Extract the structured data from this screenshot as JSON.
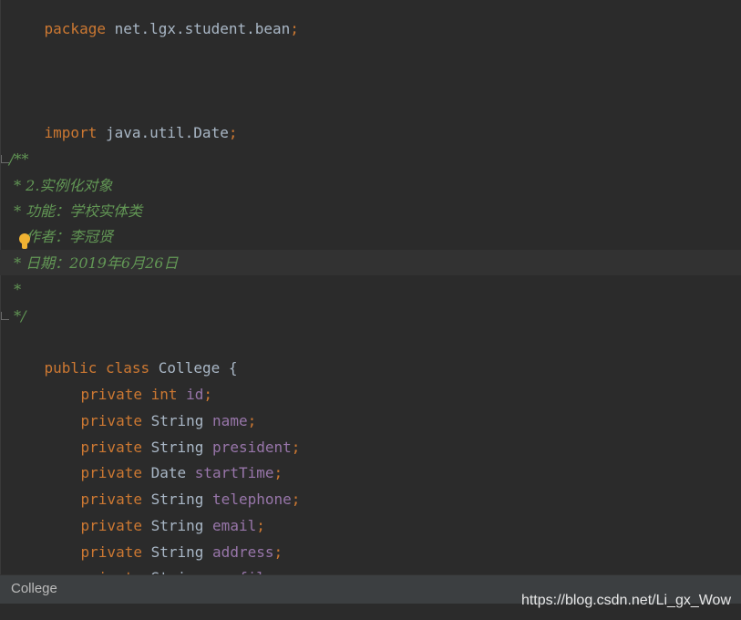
{
  "editor": {
    "package_line": {
      "keyword": "package",
      "name": "net.lgx.student.bean",
      "semi": ";"
    },
    "import_line": {
      "keyword": "import",
      "name": "java.util.Date",
      "semi": ";"
    },
    "javadoc": {
      "open": "/**",
      "line1": " * 2.实例化对象",
      "line2": " * 功能：学校实体类",
      "line3_prefix": " * ",
      "line3": "作者：李冠贤",
      "line4": " * 日期：2019年6月26日",
      "line5": " *",
      "close": " */"
    },
    "class_decl": {
      "kw1": "public",
      "kw2": "class",
      "name": "College",
      "brace": "{"
    },
    "fields": [
      {
        "mod": "private",
        "type": "int",
        "name": "id",
        "type_is_keyword": true
      },
      {
        "mod": "private",
        "type": "String",
        "name": "name"
      },
      {
        "mod": "private",
        "type": "String",
        "name": "president"
      },
      {
        "mod": "private",
        "type": "Date",
        "name": "startTime"
      },
      {
        "mod": "private",
        "type": "String",
        "name": "telephone"
      },
      {
        "mod": "private",
        "type": "String",
        "name": "email"
      },
      {
        "mod": "private",
        "type": "String",
        "name": "address"
      },
      {
        "mod": "private",
        "type": "String",
        "name": "profile"
      }
    ],
    "semi": ";"
  },
  "statusbar": {
    "breadcrumb": "College"
  },
  "watermark": "https://blog.csdn.net/Li_gx_Wow",
  "icons": {
    "intention": "lightbulb-icon"
  },
  "colors": {
    "background": "#2b2b2b",
    "keyword": "#cc7832",
    "field": "#9876aa",
    "comment": "#629755",
    "text": "#a9b7c6"
  }
}
